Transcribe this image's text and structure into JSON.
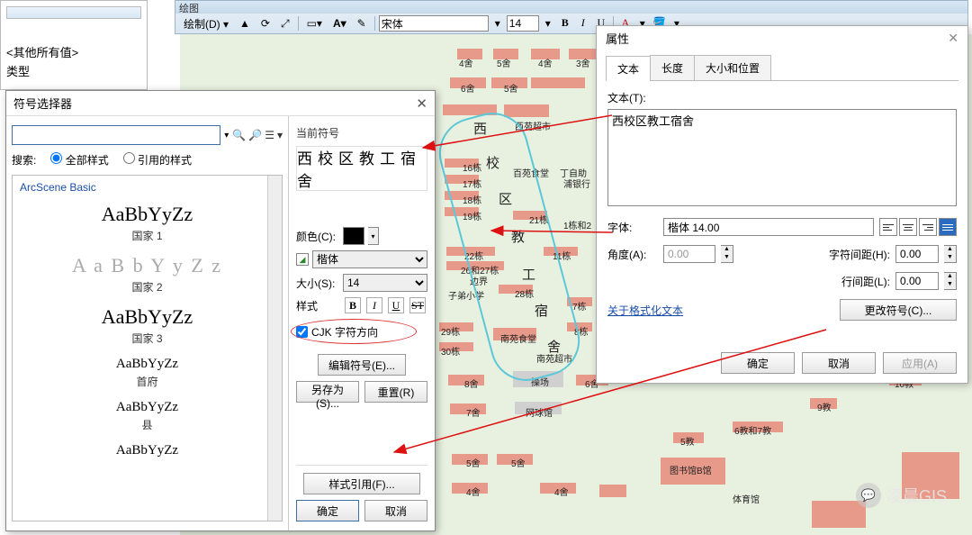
{
  "toc": {
    "other_values": "<其他所有值>",
    "type_label": "类型"
  },
  "draw_toolbar": {
    "title": "绘图",
    "draw_menu": "绘制(D) ▾",
    "font": "宋体",
    "size": "14"
  },
  "symbol_selector": {
    "title": "符号选择器",
    "search_label": "搜索:",
    "opt_all": "全部样式",
    "opt_ref": "引用的样式",
    "group": "ArcScene Basic",
    "items": [
      {
        "sample": "AaBbYyZz",
        "caption": "国家 1",
        "cls": ""
      },
      {
        "sample": "A a B b Y y Z z",
        "caption": "国家 2",
        "cls": "gray"
      },
      {
        "sample": "AaBbYyZz",
        "caption": "国家 3",
        "cls": ""
      },
      {
        "sample": "AaBbYyZz",
        "caption": "首府",
        "cls": "small"
      },
      {
        "sample": "AaBbYyZz",
        "caption": "县",
        "cls": "small"
      },
      {
        "sample": "AaBbYyZz",
        "caption": "",
        "cls": "small"
      }
    ],
    "current_label": "当前符号",
    "preview_text": "西校区教工宿舍",
    "color_label": "颜色(C):",
    "font_value": "楷体",
    "size_label": "大小(S):",
    "size_value": "14",
    "style_label": "样式",
    "cjk_label": "CJK 字符方向",
    "edit_btn": "编辑符号(E)...",
    "saveas_btn": "另存为(S)...",
    "reset_btn": "重置(R)",
    "style_ref_btn": "样式引用(F)...",
    "ok": "确定",
    "cancel": "取消"
  },
  "properties": {
    "title": "属性",
    "tabs": {
      "text": "文本",
      "length": "长度",
      "sizepos": "大小和位置"
    },
    "text_label": "文本(T):",
    "text_value": "西校区教工宿舍",
    "font_label": "字体:",
    "font_value": "楷体 14.00",
    "angle_label": "角度(A):",
    "angle_value": "0.00",
    "charspace_label": "字符间距(H):",
    "charspace_value": "0.00",
    "linespace_label": "行间距(L):",
    "linespace_value": "0.00",
    "format_link": "关于格式化文本",
    "change_symbol": "更改符号(C)...",
    "ok": "确定",
    "cancel": "取消",
    "apply": "应用(A)"
  },
  "map_labels": {
    "l1": "4舍",
    "l2": "5舍",
    "l3": "4舍",
    "l4": "3舍",
    "supermket": "西苑超市",
    "l5": "5舍",
    "l6": "6舍",
    "l7": "16栋",
    "canteen1": "百苑食堂",
    "atm": "丁自助",
    "bank": "浦银行",
    "l8": "17栋",
    "l9": "18栋",
    "l10": "19栋",
    "l11": "21栋",
    "l12": "1栋和2",
    "l13": "22栋",
    "l14": "11栋",
    "l15": "26和27栋",
    "boundary": "边界",
    "primary": "子弟小学",
    "l16": "28栋",
    "l17": "7栋",
    "l18": "29栋",
    "canteen2": "南苑食堂",
    "l19": "8栋",
    "l20": "30栋",
    "supermkt2": "南苑超市",
    "l21": "8舍",
    "playground": "操场",
    "l22": "6舍",
    "l23": "7舍",
    "tennis": "网球馆",
    "l24": "9教",
    "l25": "10教",
    "l26": "6教和7教",
    "l27": "5教",
    "l28": "5舍",
    "l29": "5舍",
    "library": "图书馆B馆",
    "l30": "4舍",
    "l31": "4舍",
    "gym": "体育馆",
    "vert1": "西",
    "vert2": "校",
    "vert3": "区",
    "vert4": "教",
    "vert5": "工",
    "vert6": "宿",
    "vert7": "舍"
  },
  "watermark": "凌晨GIS"
}
